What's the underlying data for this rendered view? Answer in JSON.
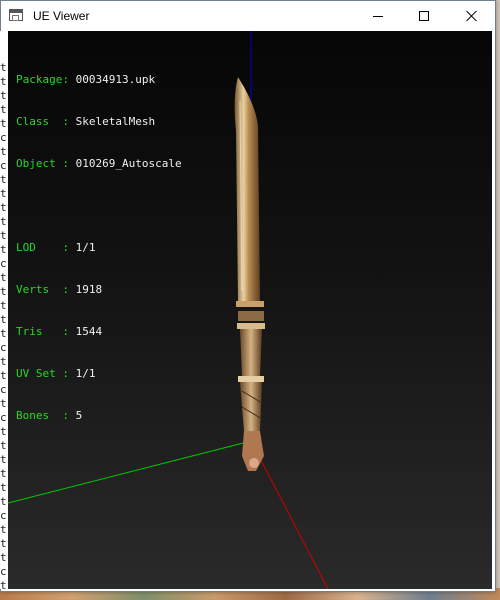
{
  "window": {
    "title": "UE Viewer"
  },
  "info": {
    "package": {
      "label": "Package:",
      "value": "00034913.upk"
    },
    "class": {
      "label": "Class  :",
      "value": "SkeletalMesh"
    },
    "object": {
      "label": "Object :",
      "value": "010269_Autoscale"
    },
    "lod": {
      "label": "LOD    :",
      "value": "1/1"
    },
    "verts": {
      "label": "Verts  :",
      "value": "1918"
    },
    "tris": {
      "label": "Tris   :",
      "value": "1544"
    },
    "uvset": {
      "label": "UV Set :",
      "value": "1/1"
    },
    "bones": {
      "label": "Bones  :",
      "value": "5"
    }
  },
  "left_margin_letters": [
    "t",
    "t",
    "t",
    "t",
    "t",
    "c",
    "t",
    "c",
    "t",
    "t",
    "t",
    "t",
    "t",
    "t",
    "c",
    "t",
    "t",
    "t",
    "t",
    "t",
    "c",
    "t",
    "t",
    "c",
    "t",
    "c",
    "t",
    "t",
    "t",
    "t",
    "t",
    "t",
    "c",
    "t",
    "t",
    "t",
    "c",
    "t",
    "t"
  ],
  "colors": {
    "label_green": "#2bd62b",
    "axis_x": "#cc0000",
    "axis_y": "#00cc00",
    "axis_z": "#0000cc"
  }
}
